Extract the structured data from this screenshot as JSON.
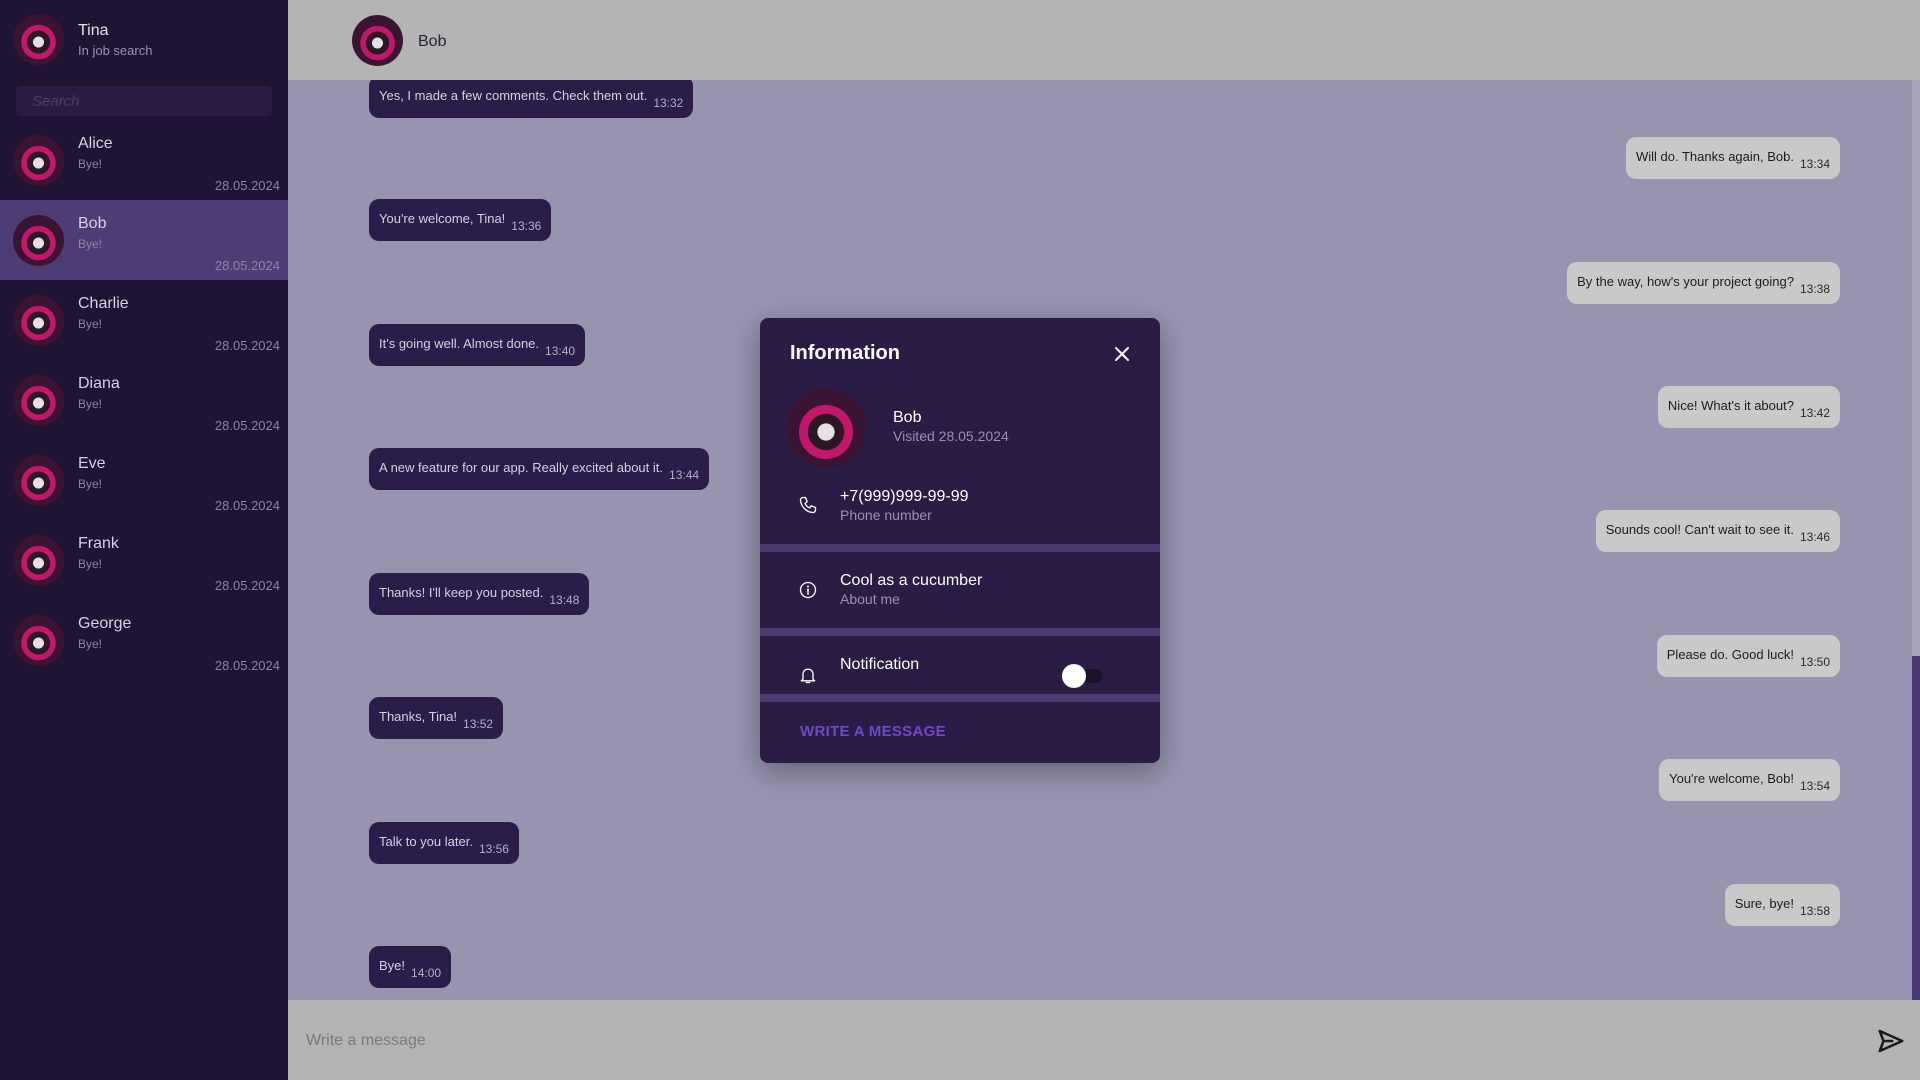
{
  "me": {
    "name": "Tina",
    "status": "In job search"
  },
  "search": {
    "placeholder": "Search"
  },
  "contacts": [
    {
      "name": "Alice",
      "last": "Bye!",
      "date": "28.05.2024"
    },
    {
      "name": "Bob",
      "last": "Bye!",
      "date": "28.05.2024"
    },
    {
      "name": "Charlie",
      "last": "Bye!",
      "date": "28.05.2024"
    },
    {
      "name": "Diana",
      "last": "Bye!",
      "date": "28.05.2024"
    },
    {
      "name": "Eve",
      "last": "Bye!",
      "date": "28.05.2024"
    },
    {
      "name": "Frank",
      "last": "Bye!",
      "date": "28.05.2024"
    },
    {
      "name": "George",
      "last": "Bye!",
      "date": "28.05.2024"
    }
  ],
  "chat": {
    "name": "Bob",
    "messages": [
      {
        "dir": "in",
        "text": "Yes, I made a few comments. Check them out.",
        "time": "13:32"
      },
      {
        "dir": "out",
        "text": "Will do. Thanks again, Bob.",
        "time": "13:34"
      },
      {
        "dir": "in",
        "text": "You're welcome, Tina!",
        "time": "13:36"
      },
      {
        "dir": "out",
        "text": "By the way, how's your project going?",
        "time": "13:38"
      },
      {
        "dir": "in",
        "text": "It's going well. Almost done.",
        "time": "13:40"
      },
      {
        "dir": "out",
        "text": "Nice! What's it about?",
        "time": "13:42"
      },
      {
        "dir": "in",
        "text": "A new feature for our app. Really excited about it.",
        "time": "13:44"
      },
      {
        "dir": "out",
        "text": "Sounds cool! Can't wait to see it.",
        "time": "13:46"
      },
      {
        "dir": "in",
        "text": "Thanks! I'll keep you posted.",
        "time": "13:48"
      },
      {
        "dir": "out",
        "text": "Please do. Good luck!",
        "time": "13:50"
      },
      {
        "dir": "in",
        "text": "Thanks, Tina!",
        "time": "13:52"
      },
      {
        "dir": "out",
        "text": "You're welcome, Bob!",
        "time": "13:54"
      },
      {
        "dir": "in",
        "text": "Talk to you later.",
        "time": "13:56"
      },
      {
        "dir": "out",
        "text": "Sure, bye!",
        "time": "13:58"
      },
      {
        "dir": "in",
        "text": "Bye!",
        "time": "14:00"
      }
    ]
  },
  "composer": {
    "placeholder": "Write a message"
  },
  "modal": {
    "title": "Information",
    "name": "Bob",
    "visited": "Visited 28.05.2024",
    "phone": "+7(999)999-99-99",
    "phone_label": "Phone number",
    "about": "Cool as a cucumber",
    "about_label": "About me",
    "notification_label": "Notification",
    "notification_enabled": false,
    "write_button": "WRITE A MESSAGE"
  },
  "colors": {
    "sidebar_bg": "#1f1433",
    "active_contact_bg": "#4e3c74",
    "chat_bg": "#9894b0",
    "incoming_bubble": "#2b1d49",
    "outgoing_bubble": "#c9c9c9",
    "modal_bg": "#2a1c45",
    "accent": "#7048c8"
  },
  "icons": {
    "send": "send-icon",
    "close": "close-icon",
    "phone": "phone-icon",
    "info": "info-icon",
    "bell": "bell-icon"
  }
}
